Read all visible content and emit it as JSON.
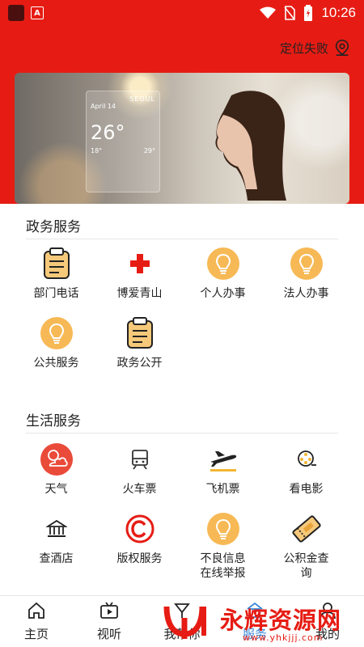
{
  "status_bar": {
    "time": "10:26"
  },
  "header": {
    "locate_label": "定位失败",
    "bg_color": "#e61c14"
  },
  "banner": {
    "city": "SEOUL",
    "date": "April 14",
    "temp": "26°",
    "hi": "18°",
    "lo": "29°"
  },
  "gov_services": {
    "title": "政务服务",
    "items": [
      {
        "label": "部门电话",
        "icon": "clipboard-icon"
      },
      {
        "label": "博爱青山",
        "icon": "red-cross-icon"
      },
      {
        "label": "个人办事",
        "icon": "lightbulb-icon"
      },
      {
        "label": "法人办事",
        "icon": "lightbulb-icon"
      },
      {
        "label": "公共服务",
        "icon": "lightbulb-icon"
      },
      {
        "label": "政务公开",
        "icon": "clipboard-icon"
      }
    ]
  },
  "life_services": {
    "title": "生活服务",
    "items": [
      {
        "label": "天气",
        "icon": "weather-icon"
      },
      {
        "label": "火车票",
        "icon": "train-icon"
      },
      {
        "label": "飞机票",
        "icon": "plane-icon"
      },
      {
        "label": "看电影",
        "icon": "film-reel-icon"
      },
      {
        "label": "查酒店",
        "icon": "hotel-icon"
      },
      {
        "label": "版权服务",
        "icon": "copyright-icon"
      },
      {
        "label": "不良信息\n在线举报",
        "icon": "lightbulb-icon"
      },
      {
        "label": "公积金查\n询",
        "icon": "ticket-icon"
      }
    ]
  },
  "bottom_nav": {
    "items": [
      {
        "label": "主页",
        "icon": "home-icon"
      },
      {
        "label": "视听",
        "icon": "video-icon"
      },
      {
        "label": "我帮你",
        "icon": "help-icon"
      },
      {
        "label": "服务",
        "icon": "service-icon"
      },
      {
        "label": "我的",
        "icon": "user-icon"
      }
    ],
    "active": "服务"
  },
  "watermark": {
    "text": "永辉资源网",
    "url": "www.yhkjjj.com"
  }
}
